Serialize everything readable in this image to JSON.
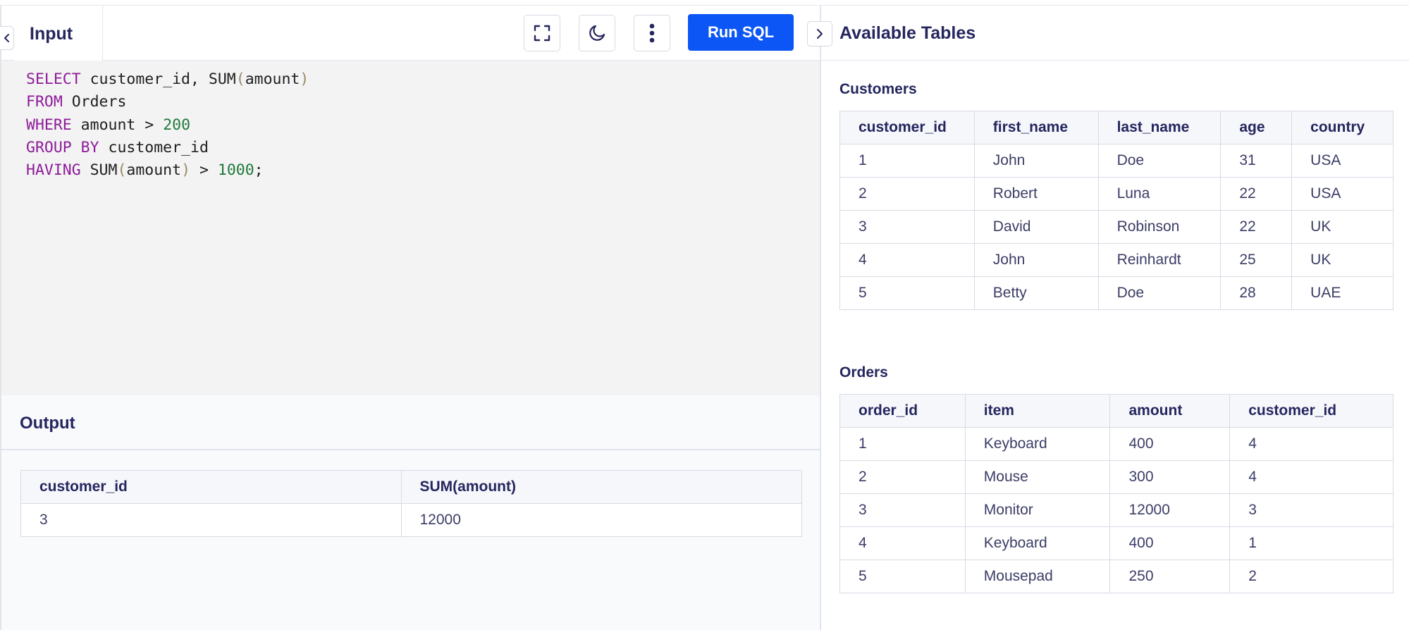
{
  "editor": {
    "tab_label": "Input",
    "icons": [
      "fullscreen-icon",
      "moon-icon",
      "more-vertical-icon"
    ],
    "run_label": "Run SQL",
    "code_lines": [
      [
        {
          "t": "SELECT",
          "c": "kw"
        },
        {
          "t": " customer_id, SUM",
          "c": ""
        },
        {
          "t": "(",
          "c": "par"
        },
        {
          "t": "amount",
          "c": ""
        },
        {
          "t": ")",
          "c": "par"
        }
      ],
      [
        {
          "t": "FROM",
          "c": "kw"
        },
        {
          "t": " Orders",
          "c": ""
        }
      ],
      [
        {
          "t": "WHERE",
          "c": "kw"
        },
        {
          "t": " amount > ",
          "c": ""
        },
        {
          "t": "200",
          "c": "num"
        }
      ],
      [
        {
          "t": "GROUP BY",
          "c": "kw"
        },
        {
          "t": " customer_id",
          "c": ""
        }
      ],
      [
        {
          "t": "HAVING",
          "c": "kw"
        },
        {
          "t": " SUM",
          "c": ""
        },
        {
          "t": "(",
          "c": "par"
        },
        {
          "t": "amount",
          "c": ""
        },
        {
          "t": ")",
          "c": "par"
        },
        {
          "t": " > ",
          "c": ""
        },
        {
          "t": "1000",
          "c": "num"
        },
        {
          "t": ";",
          "c": ""
        }
      ]
    ]
  },
  "output": {
    "title": "Output",
    "columns": [
      "customer_id",
      "SUM(amount)"
    ],
    "column_widths": [
      540,
      569
    ],
    "rows": [
      [
        "3",
        "12000"
      ]
    ]
  },
  "tables_panel": {
    "title": "Available Tables",
    "customers": {
      "caption": "Customers",
      "columns": [
        "customer_id",
        "first_name",
        "last_name",
        "age",
        "country"
      ],
      "column_widths": [
        191,
        176,
        174,
        101,
        144
      ],
      "rows": [
        [
          "1",
          "John",
          "Doe",
          "31",
          "USA"
        ],
        [
          "2",
          "Robert",
          "Luna",
          "22",
          "USA"
        ],
        [
          "3",
          "David",
          "Robinson",
          "22",
          "UK"
        ],
        [
          "4",
          "John",
          "Reinhardt",
          "25",
          "UK"
        ],
        [
          "5",
          "Betty",
          "Doe",
          "28",
          "UAE"
        ]
      ]
    },
    "orders": {
      "caption": "Orders",
      "columns": [
        "order_id",
        "item",
        "amount",
        "customer_id"
      ],
      "column_widths": [
        178,
        206,
        170,
        232
      ],
      "rows": [
        [
          "1",
          "Keyboard",
          "400",
          "4"
        ],
        [
          "2",
          "Mouse",
          "300",
          "4"
        ],
        [
          "3",
          "Monitor",
          "12000",
          "3"
        ],
        [
          "4",
          "Keyboard",
          "400",
          "1"
        ],
        [
          "5",
          "Mousepad",
          "250",
          "2"
        ]
      ]
    }
  },
  "colors": {
    "run_button": "#0b56f5",
    "keyword": "#8e1c9a",
    "number": "#1f7a3c",
    "text": "#25265e"
  }
}
